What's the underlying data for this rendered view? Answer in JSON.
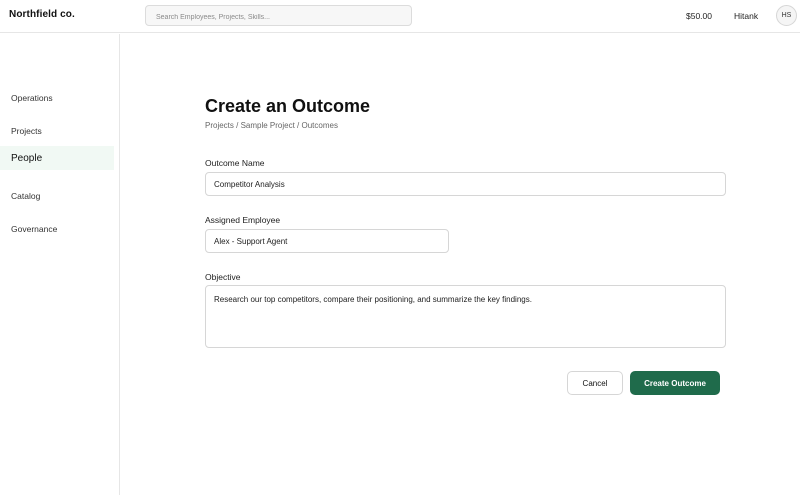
{
  "app": {
    "brand": "Northfield co."
  },
  "header": {
    "search_placeholder": "Search Employees, Projects, Skills...",
    "balance": "$50.00",
    "username": "Hitank",
    "avatar_initials": "HS"
  },
  "sidebar": {
    "items": [
      {
        "label": "Operations",
        "active": false
      },
      {
        "label": "Projects",
        "active": false
      },
      {
        "label": "People",
        "active": true
      },
      {
        "label": "Catalog",
        "active": false
      },
      {
        "label": "Governance",
        "active": false
      }
    ]
  },
  "form": {
    "title": "Create an Outcome",
    "breadcrumb": "Projects / Sample Project / Outcomes",
    "outcome_name_label": "Outcome Name",
    "outcome_name_value": "Competitor Analysis",
    "assigned_employee_label": "Assigned Employee",
    "assigned_employee_value": "Alex - Support Agent",
    "objective_label": "Objective",
    "objective_value": "Research our top competitors, compare their positioning, and summarize the key findings.",
    "cancel_label": "Cancel",
    "submit_label": "Create Outcome"
  },
  "colors": {
    "accent": "#1f6b4b",
    "active_nav_bg": "#f1f9f4"
  }
}
